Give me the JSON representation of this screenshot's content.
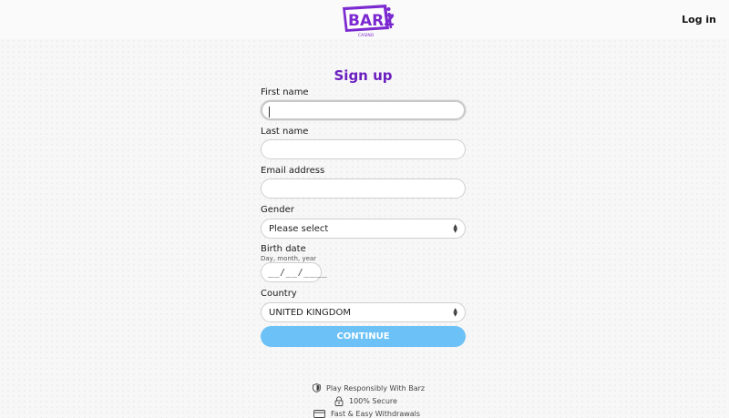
{
  "header": {
    "logo_text": "BARZ",
    "logo_sub": "CASINO",
    "login_label": "Log in"
  },
  "form": {
    "title": "Sign up",
    "first_name": {
      "label": "First name",
      "value": ""
    },
    "last_name": {
      "label": "Last name",
      "value": ""
    },
    "email": {
      "label": "Email address",
      "value": ""
    },
    "gender": {
      "label": "Gender",
      "selected": "Please select"
    },
    "birth_date": {
      "label": "Birth date",
      "hint": "Day, month, year",
      "placeholder": "__/__/____"
    },
    "country": {
      "label": "Country",
      "selected": "UNITED KINGDOM"
    },
    "continue_label": "CONTINUE"
  },
  "footer": {
    "items": [
      "Play Responsibly With Barz",
      "100% Secure",
      "Fast & Easy Withdrawals"
    ]
  },
  "colors": {
    "brand_purple": "#6b1fbf",
    "continue_blue": "#6cc2f6"
  }
}
